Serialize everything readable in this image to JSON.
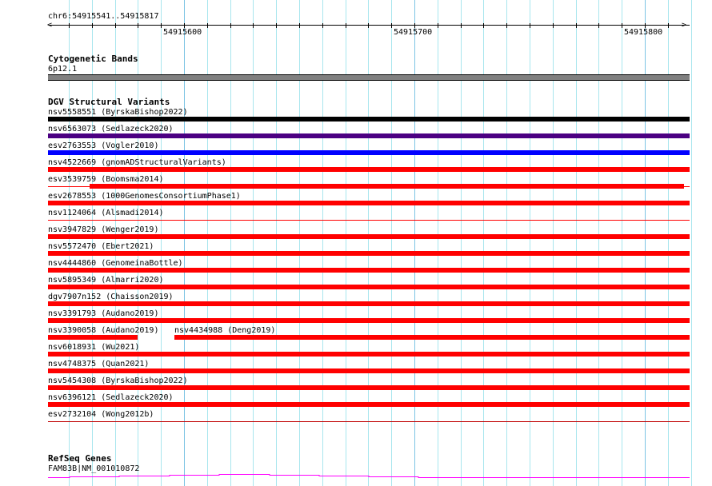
{
  "view": {
    "chrom": "chr6",
    "start": 54915541,
    "end": 54915819,
    "location_label": "chr6:54915541..54915817"
  },
  "ruler": {
    "labels": [
      "54915600",
      "54915700",
      "54915800"
    ],
    "label_positions_bp": [
      54915600,
      54915700,
      54915800
    ]
  },
  "cytoband": {
    "title": "Cytogenetic Bands",
    "band": "6p12.1",
    "color": "#808080"
  },
  "dgv": {
    "title": "DGV Structural Variants",
    "rows": [
      {
        "label": "nsv5558551 (ByrskaBishop2022)",
        "color": "#000000",
        "style": "thick"
      },
      {
        "label": "nsv6563073 (Sedlazeck2020)",
        "color": "#4b0082",
        "style": "thick"
      },
      {
        "label": "esv2763553 (Vogler2010)",
        "color": "#0000ff",
        "style": "thick"
      },
      {
        "label": "nsv4522669 (gnomADStructuralVariants)",
        "color": "#ff0000",
        "style": "thick"
      },
      {
        "label": "esv3539759 (Boomsma2014)",
        "color": "#ff0000",
        "style": "thin+thick",
        "thick_start": 54915559,
        "thick_end": 54915817
      },
      {
        "label": "esv2678553 (1000GenomesConsortiumPhase1)",
        "color": "#ff0000",
        "style": "thick"
      },
      {
        "label": "nsv1124064 (Alsmadi2014)",
        "color": "#ff0000",
        "style": "thin"
      },
      {
        "label": "nsv3947829 (Wenger2019)",
        "color": "#ff0000",
        "style": "thick"
      },
      {
        "label": "nsv5572470 (Ebert2021)",
        "color": "#ff0000",
        "style": "thick"
      },
      {
        "label": "nsv4444860 (GenomeinaBottle)",
        "color": "#ff0000",
        "style": "thick"
      },
      {
        "label": "nsv5895349 (Almarri2020)",
        "color": "#ff0000",
        "style": "thick"
      },
      {
        "label": "dgv7907n152 (Chaisson2019)",
        "color": "#ff0000",
        "style": "thick"
      },
      {
        "label": "nsv3391793 (Audano2019)",
        "color": "#ff0000",
        "style": "thick"
      },
      {
        "label": "nsv3390058 (Audano2019)",
        "color": "#ff0000",
        "style": "thick",
        "end": 54915580,
        "second": {
          "label": "nsv4434988 (Deng2019)",
          "start": 54915596
        }
      },
      {
        "label": "nsv6018931 (Wu2021)",
        "color": "#ff0000",
        "style": "thick"
      },
      {
        "label": "nsv4748375 (Quan2021)",
        "color": "#ff0000",
        "style": "thick"
      },
      {
        "label": "nsv5454308 (ByrskaBishop2022)",
        "color": "#ff0000",
        "style": "thick"
      },
      {
        "label": "nsv6396121 (Sedlazeck2020)",
        "color": "#ff0000",
        "style": "thick"
      },
      {
        "label": "esv2732104 (Wong2012b)",
        "color": "#c00000",
        "style": "thin"
      }
    ]
  },
  "refseq": {
    "title": "RefSeq Genes",
    "gene": "FAM83B|NM_001010872",
    "color": "#ff00ff"
  }
}
